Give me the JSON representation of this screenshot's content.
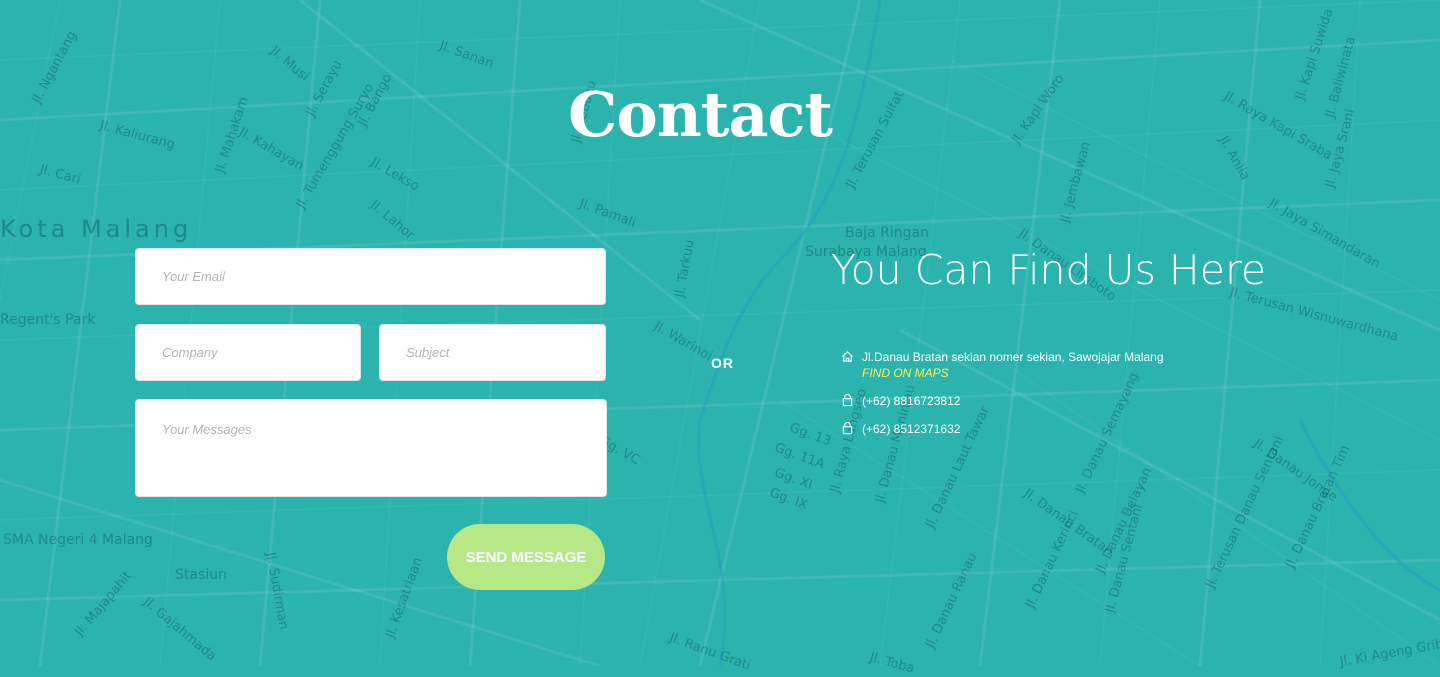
{
  "page": {
    "title": "Contact"
  },
  "map": {
    "labels": [
      "Jl. Ngantang",
      "Jl. Kaliurang",
      "Jl. Cari",
      "Kota Malang",
      "Jl. Musi",
      "Jl. Serayu",
      "Jl. Bango",
      "Jl. Kahayan",
      "Jl. Tumenggung Suryo",
      "Jl. Lekso",
      "Jl. Lahor",
      "Jl. Sanan",
      "Jl. Sebuku",
      "Jl. Pamali",
      "Jl. Mahakam",
      "Jl. Terusan Sulfat",
      "Baja Ringan",
      "Surabaya Malang",
      "Jl. Kapi Woro",
      "Jl. Jembawan",
      "Jl. Danau Limboto",
      "Jl. Raya Kapi Sraba",
      "Jl. Kapi Suwida",
      "Jl. Jaya Srani",
      "Jl. Baliwinata",
      "Jl. Jaya Simandaran",
      "Jl. Anila",
      "Jl. Terusan Wisnuwardhana",
      "Regent's Park",
      "Jl. Tarkuu",
      "Jl. Warinoi",
      "Jl. Raya Langsep",
      "Jl. Danau Maninjau",
      "Jl. Danau Laut Tawar",
      "Jl. Danau Bratan",
      "Jl. Danau Semayang",
      "Jl. Terusan Danau Sentani",
      "Jl. Danau Jonge",
      "Jl. Danau Belayan",
      "Jl. Danau Sentani",
      "Jl. Danau Kerinci",
      "Jl. Danau Ranau",
      "Jl. Danau Bratan Tim",
      "SMA Negeri 4 Malang",
      "Stasiun",
      "Jl. Majapahit",
      "Jl. Gajahmada",
      "Jl. Kesatriaan",
      "Jl. Ranu Grati",
      "Jl. Toba",
      "Jl. Ki Ageng Gribig",
      "Gg. 13",
      "Gg. 11A",
      "Gg. XI",
      "Gg. IX",
      "Gg. VC",
      "Jl. Sudirman",
      "Jl. Dipon"
    ]
  },
  "form": {
    "email_placeholder": "Your Email",
    "company_placeholder": "Company",
    "subject_placeholder": "Subject",
    "message_placeholder": "Your Messages",
    "send_label": "SEND MESSAGE"
  },
  "divider": {
    "or_label": "OR"
  },
  "find_us": {
    "heading": "You Can Find Us Here",
    "address": "Jl.Danau Bratan sekian nomer sekian, Sawojajar Malang",
    "maps_link": "FIND ON MAPS",
    "phone_1": "(+62) 8816723812",
    "phone_2": "(+62) 8512371632"
  },
  "colors": {
    "background": "#2bb3ad",
    "button": "#b6e887",
    "link": "#ffee58",
    "text": "#ffffff"
  },
  "icons": {
    "address": "home-icon",
    "phone": "phone-icon"
  }
}
